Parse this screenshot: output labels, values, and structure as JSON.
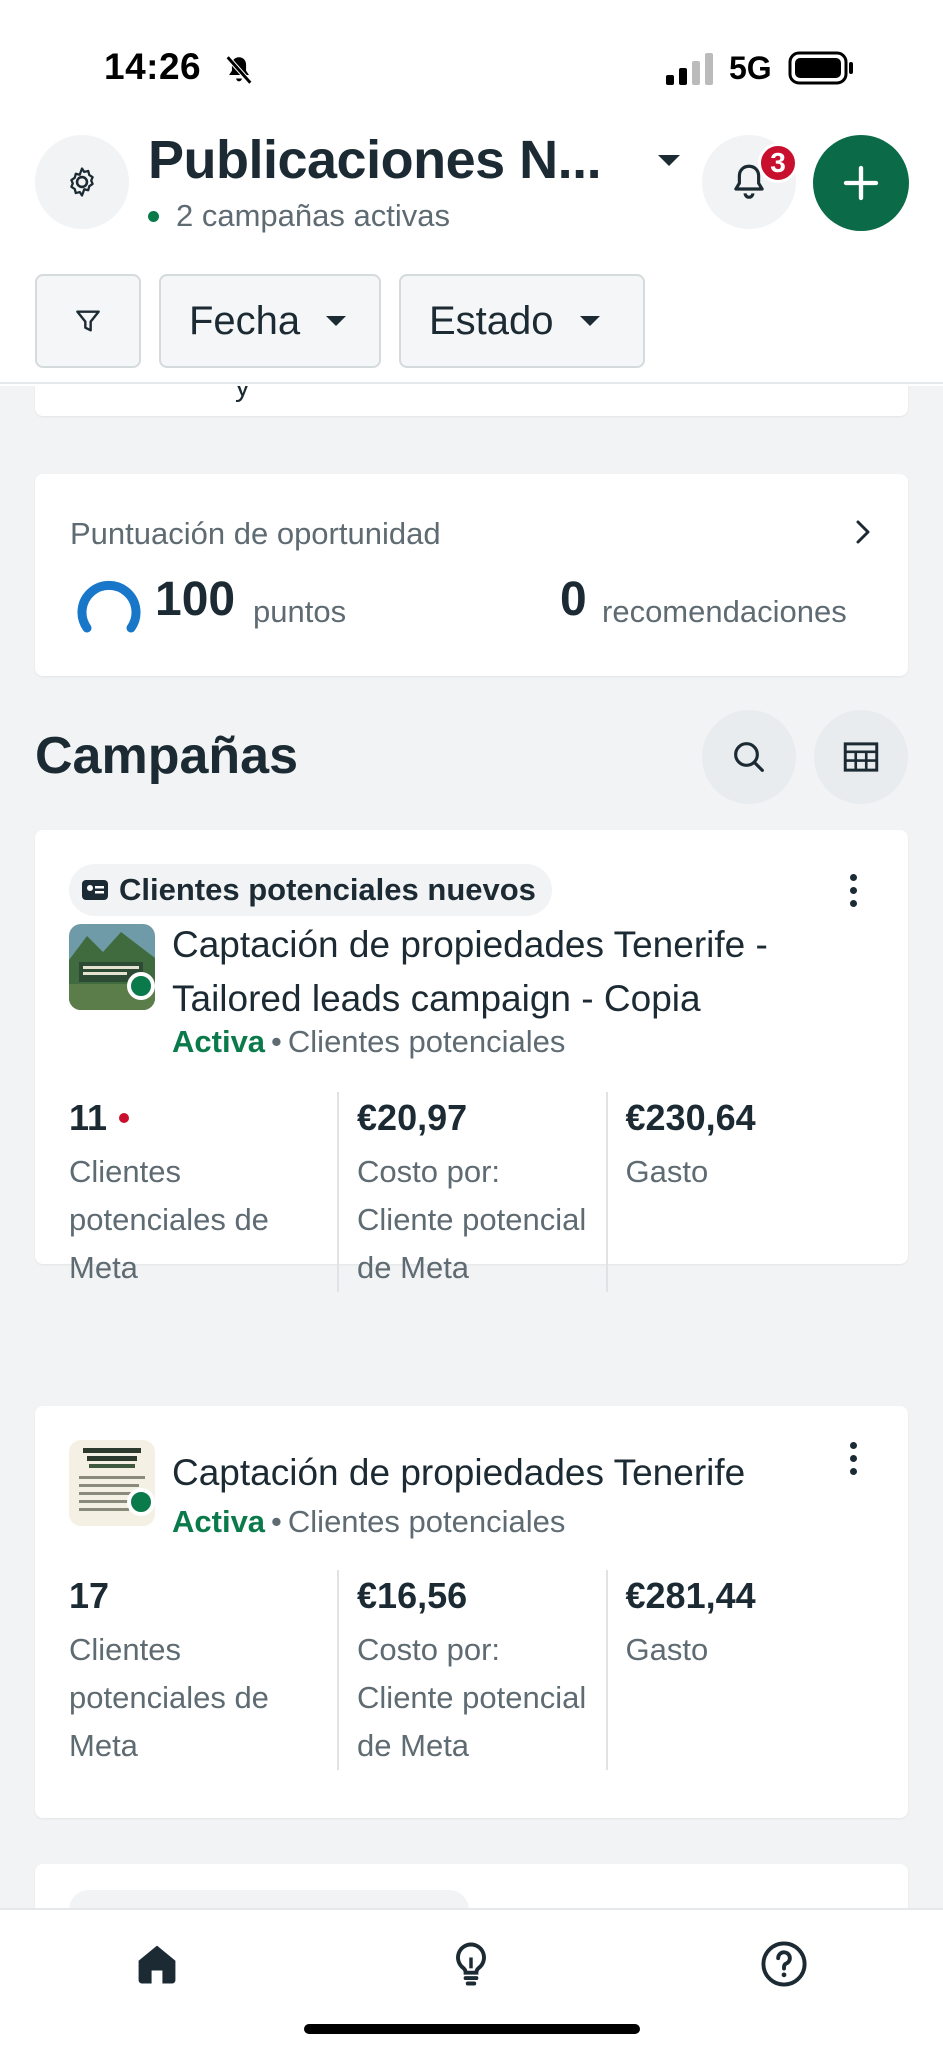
{
  "status_bar": {
    "time": "14:26",
    "network": "5G"
  },
  "header": {
    "account_name": "Publicaciones N...",
    "active_campaigns": "2 campañas activas",
    "notification_count": "3"
  },
  "filters": {
    "fecha": "Fecha",
    "estado": "Estado"
  },
  "opportunity": {
    "title": "Puntuación de oportunidad",
    "score": "100",
    "score_unit": "puntos",
    "recommendations": "0",
    "recommendations_unit": "recomendaciones"
  },
  "campaigns_section": {
    "title": "Campañas"
  },
  "campaigns": [
    {
      "objective": "Clientes potenciales nuevos",
      "name": "Captación de propiedades Tenerife - Tailored leads campaign - Copia",
      "status": "Activa",
      "type": "Clientes potenciales",
      "metrics": [
        {
          "value": "11",
          "label": "Clientes potenciales de Meta"
        },
        {
          "value": "€20,97",
          "label": "Costo por: Cliente potencial de Meta"
        },
        {
          "value": "€230,64",
          "label": "Gasto"
        }
      ]
    },
    {
      "name": "Captación de propiedades Tenerife",
      "status": "Activa",
      "type": "Clientes potenciales",
      "metrics": [
        {
          "value": "17",
          "label": "Clientes potenciales de Meta"
        },
        {
          "value": "€16,56",
          "label": "Costo por: Cliente potencial de Meta"
        },
        {
          "value": "€281,44",
          "label": "Gasto"
        }
      ]
    }
  ],
  "colors": {
    "primary_green": "#0b6b48",
    "status_green": "#0b7a4b",
    "badge_red": "#c8102e",
    "score_ring_blue": "#1877c9"
  }
}
